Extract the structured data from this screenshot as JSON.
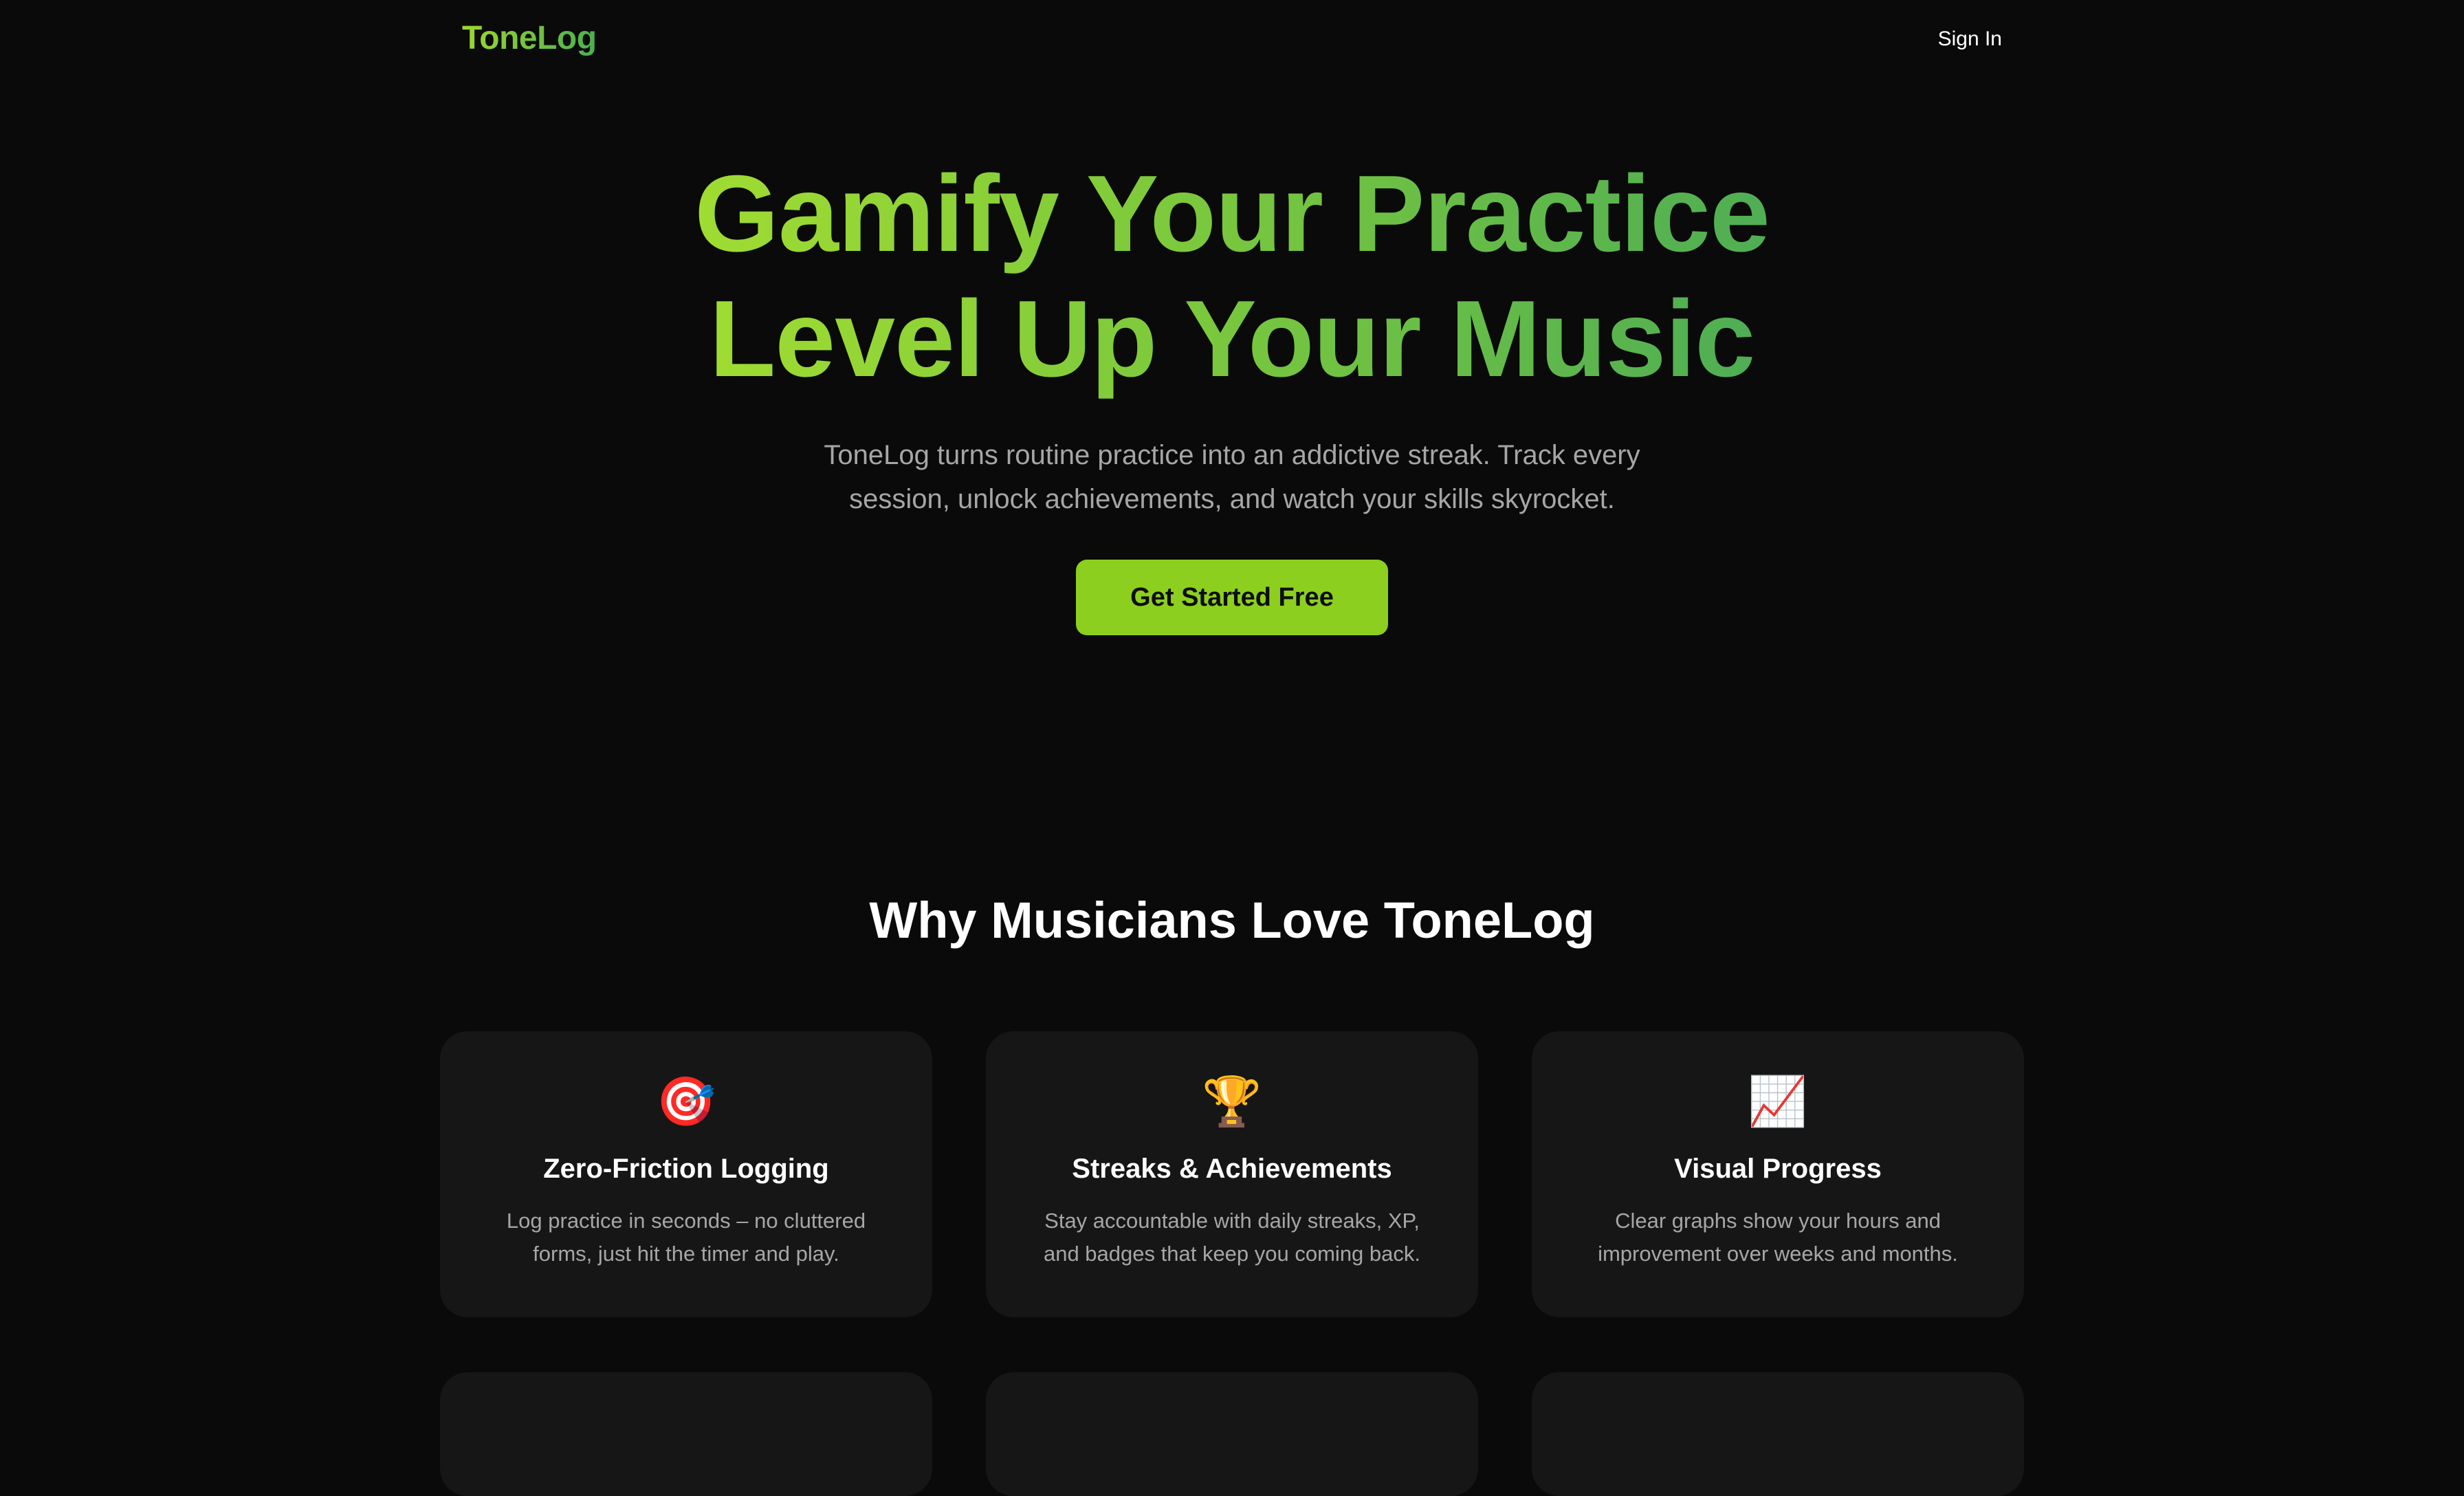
{
  "nav": {
    "logo": "ToneLog",
    "sign_in": "Sign In"
  },
  "hero": {
    "title_line1": "Gamify Your Practice",
    "title_line2": "Level Up Your Music",
    "subtitle": "ToneLog turns routine practice into an addictive streak. Track every session, unlock achievements, and watch your skills skyrocket.",
    "cta": "Get Started Free"
  },
  "features": {
    "heading": "Why Musicians Love ToneLog",
    "cards": [
      {
        "icon": "target-icon",
        "emoji": "🎯",
        "title": "Zero-Friction Logging",
        "description": "Log practice in seconds – no cluttered forms, just hit the timer and play."
      },
      {
        "icon": "trophy-icon",
        "emoji": "🏆",
        "title": "Streaks & Achievements",
        "description": "Stay accountable with daily streaks, XP, and badges that keep you coming back."
      },
      {
        "icon": "chart-increasing-icon",
        "emoji": "📈",
        "title": "Visual Progress",
        "description": "Clear graphs show your hours and improvement over weeks and months."
      }
    ]
  },
  "colors": {
    "background": "#0a0a0a",
    "card": "#161616",
    "accent": "#8ccf1f",
    "gradient_start": "#a0dc32",
    "gradient_end": "#4fae54",
    "muted_text": "#a6a6a6"
  }
}
